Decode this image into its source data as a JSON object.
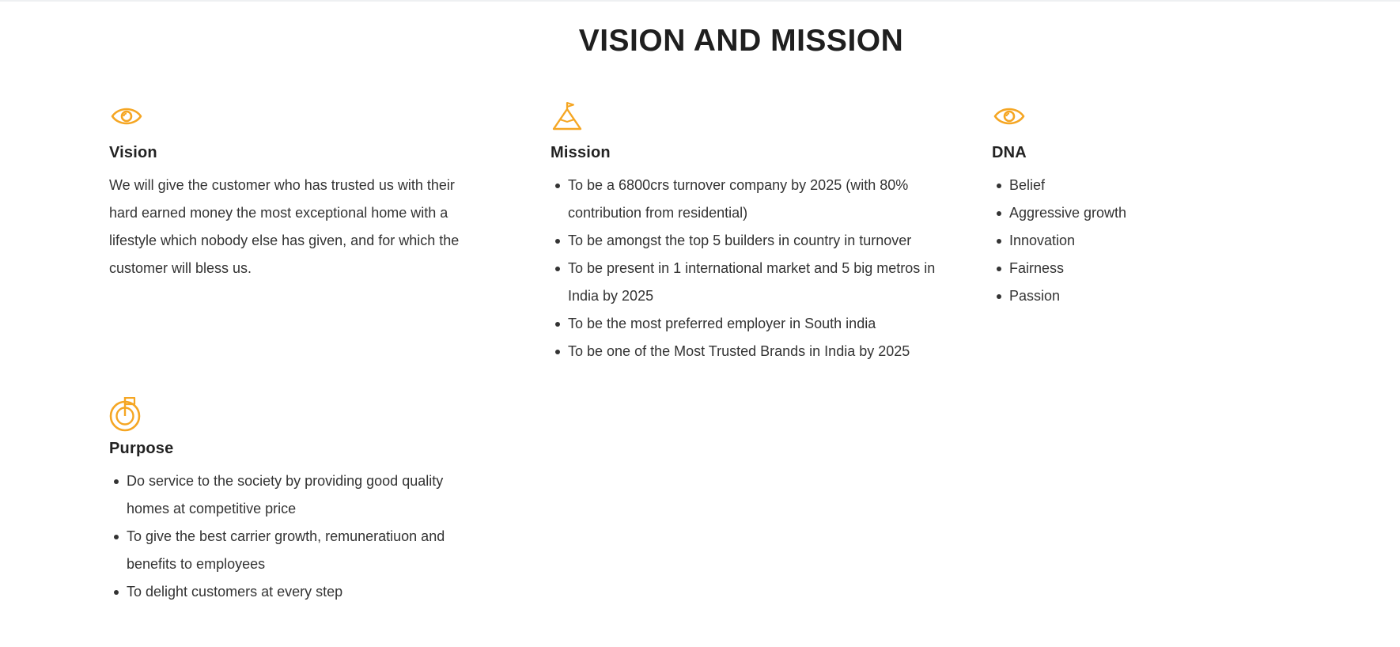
{
  "accent_color": "#f5a623",
  "page_title": "VISION AND MISSION",
  "vision": {
    "icon": "eye-icon",
    "title": "Vision",
    "text": "We will give the customer who has trusted us with their hard earned money the most exceptional home with a lifestyle which nobody else has given, and for which the customer will bless us."
  },
  "mission": {
    "icon": "mountain-flag-icon",
    "title": "Mission",
    "items": [
      "To be a 6800crs turnover company by 2025 (with 80% contribution from residential)",
      "To be amongst the top 5 builders in country in turnover",
      "To be present in 1 international market and 5 big metros in India by 2025",
      "To be the most preferred employer in South india",
      "To be one of the Most Trusted Brands in India by 2025"
    ]
  },
  "dna": {
    "icon": "eye-icon",
    "title": "DNA",
    "items": [
      "Belief",
      "Aggressive growth",
      "Innovation",
      "Fairness",
      "Passion"
    ]
  },
  "purpose": {
    "icon": "target-flag-icon",
    "title": "Purpose",
    "items": [
      "Do service to the society by providing good quality homes at competitive price",
      "To give the best carrier growth, remuneratiuon and benefits to employees",
      "To delight customers at every step"
    ]
  }
}
